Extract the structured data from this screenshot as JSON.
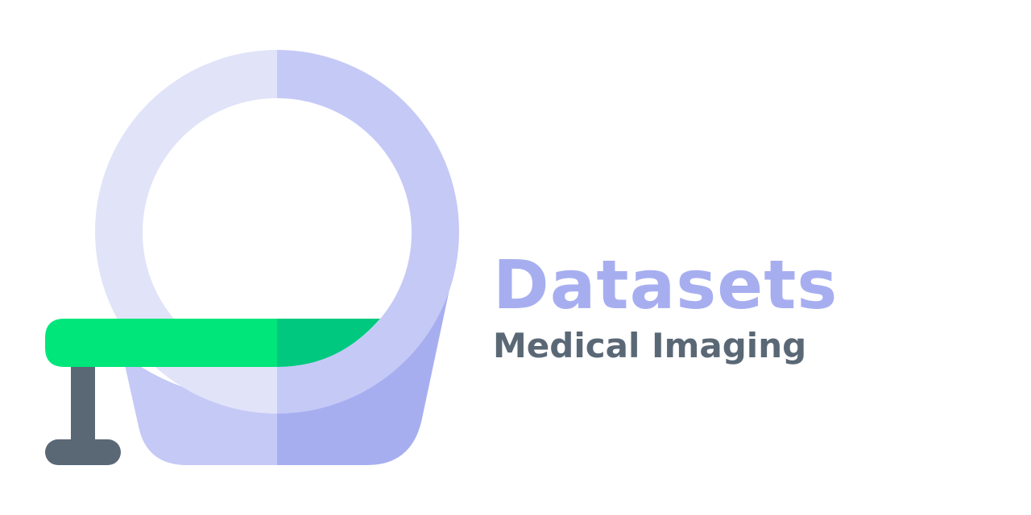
{
  "logo": {
    "icon": "mri-scanner-icon",
    "colors": {
      "ring_light": "#e1e3f9",
      "ring_mid": "#c5c9f6",
      "base_dark": "#a7aef0",
      "table_green": "#00e67a",
      "table_green_dark": "#00c97f",
      "stand": "#5a6876"
    }
  },
  "heading": {
    "title": "Datasets",
    "subtitle": "Medical Imaging",
    "title_color": "#a7aef0",
    "subtitle_color": "#5a6876"
  }
}
